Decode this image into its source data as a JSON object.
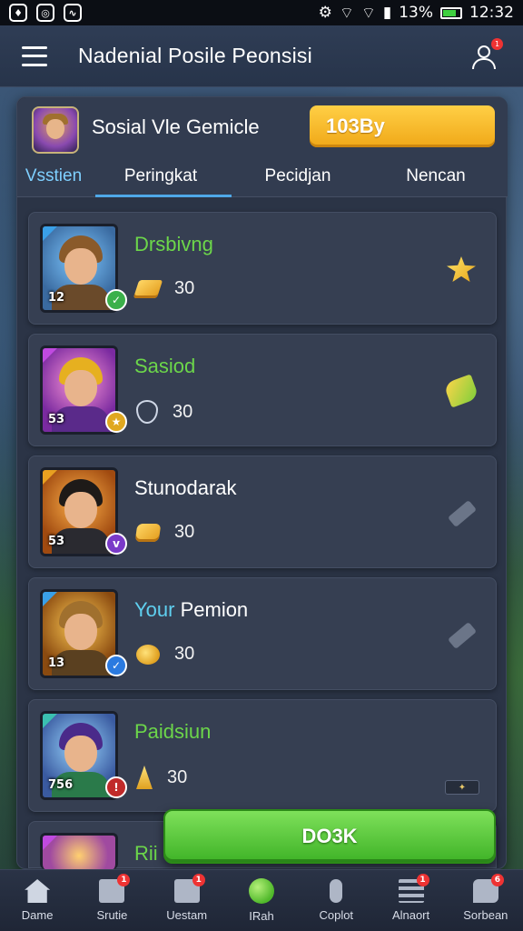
{
  "status_bar": {
    "left_icons": [
      "fire-icon",
      "target-icon",
      "chart-icon"
    ],
    "battery": "13%",
    "time": "12:32"
  },
  "app_bar": {
    "title": "Nadenial Posile Peonsisi"
  },
  "header_card": {
    "title": "Sosial Vle Gemicle",
    "badge": "103By"
  },
  "tabs": [
    {
      "label": "Vsstien"
    },
    {
      "label": "Peringkat"
    },
    {
      "label": "Pecidjan"
    },
    {
      "label": "Nencan"
    }
  ],
  "rows": [
    {
      "rank": "12",
      "name": "Drsbivng",
      "value": "30",
      "stat_icon": "gold-bar-icon",
      "action_icon": "star-icon",
      "name_color": "#6cd64a"
    },
    {
      "rank": "53",
      "name": "Sasiod",
      "value": "30",
      "stat_icon": "shield-icon",
      "action_icon": "leaf-icon",
      "name_color": "#6cd64a"
    },
    {
      "rank": "53",
      "name": "Stunodarak",
      "value": "30",
      "stat_icon": "gold-nugget-icon",
      "action_icon": "pencil-icon",
      "name_color": "#ffffff"
    },
    {
      "rank": "13",
      "name_prefix": "Your",
      "name": "Pemion",
      "value": "30",
      "stat_icon": "gem-icon",
      "action_icon": "pencil-icon",
      "name_color": "#ffffff"
    },
    {
      "rank": "756",
      "name": "Paidsiun",
      "value": "30",
      "stat_icon": "drop-icon",
      "action_icon": "flag-icon",
      "name_color": "#6cd64a"
    },
    {
      "name": "Rii"
    }
  ],
  "cta": {
    "label": "DO3K"
  },
  "bottom_nav": [
    {
      "label": "Dame",
      "icon": "home-icon"
    },
    {
      "label": "Srutie",
      "icon": "mail-icon",
      "badge": "1"
    },
    {
      "label": "Uestam",
      "icon": "check-icon",
      "badge": "1"
    },
    {
      "label": "IRah",
      "icon": "ball-icon"
    },
    {
      "label": "Coplot",
      "icon": "mic-icon"
    },
    {
      "label": "Alnaort",
      "icon": "list-icon",
      "badge": "1"
    },
    {
      "label": "Sorbean",
      "icon": "chat-icon",
      "badge": "6"
    }
  ],
  "colors": {
    "accent_gold": "#f0a818",
    "accent_green": "#3fb327",
    "tab_underline": "#4fa8e8",
    "panel": "#2b3446"
  }
}
